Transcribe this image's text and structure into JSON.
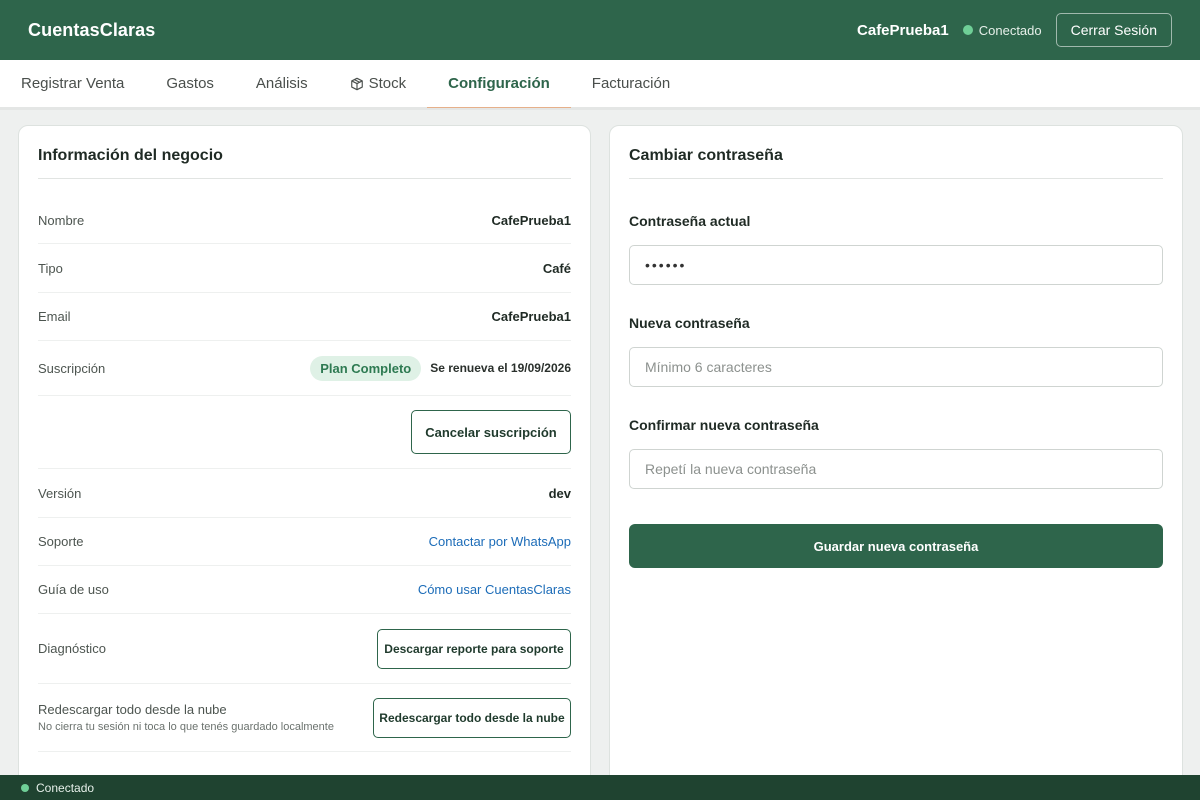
{
  "header": {
    "brand": "CuentasClaras",
    "user": "CafePrueba1",
    "connection_status": "Conectado",
    "logout_label": "Cerrar Sesión"
  },
  "tabs": [
    {
      "label": "Registrar Venta",
      "active": false
    },
    {
      "label": "Gastos",
      "active": false
    },
    {
      "label": "Análisis",
      "active": false
    },
    {
      "label": "Stock",
      "active": false,
      "icon": "box-icon"
    },
    {
      "label": "Configuración",
      "active": true
    },
    {
      "label": "Facturación",
      "active": false
    }
  ],
  "business_info": {
    "title": "Información del negocio",
    "name_label": "Nombre",
    "name_value": "CafePrueba1",
    "type_label": "Tipo",
    "type_value": "Café",
    "email_label": "Email",
    "email_value": "CafePrueba1",
    "subscription_label": "Suscripción",
    "subscription_badge": "Plan Completo",
    "subscription_renewal": "Se renueva el 19/09/2026",
    "cancel_subscription_label": "Cancelar suscripción",
    "version_label": "Versión",
    "version_value": "dev",
    "support_label": "Soporte",
    "support_link": "Contactar por WhatsApp",
    "guide_label": "Guía de uso",
    "guide_link": "Cómo usar CuentasClaras",
    "diagnostic_label": "Diagnóstico",
    "diagnostic_button": "Descargar reporte para soporte",
    "redownload_label": "Redescargar todo desde la nube",
    "redownload_note": "No cierra tu sesión ni toca lo que tenés guardado localmente",
    "redownload_button": "Redescargar todo desde la nube"
  },
  "password": {
    "title": "Cambiar contraseña",
    "current_label": "Contraseña actual",
    "current_value": "••••••",
    "new_label": "Nueva contraseña",
    "new_placeholder": "Mínimo 6 caracteres",
    "confirm_label": "Confirmar nueva contraseña",
    "confirm_placeholder": "Repetí la nueva contraseña",
    "save_label": "Guardar nueva contraseña"
  },
  "statusbar": {
    "text": "Conectado"
  },
  "colors": {
    "brand_green": "#2e654b",
    "status_green": "#6fcf97",
    "link_blue": "#1c6cb8",
    "tab_underline": "#e6b08a"
  }
}
